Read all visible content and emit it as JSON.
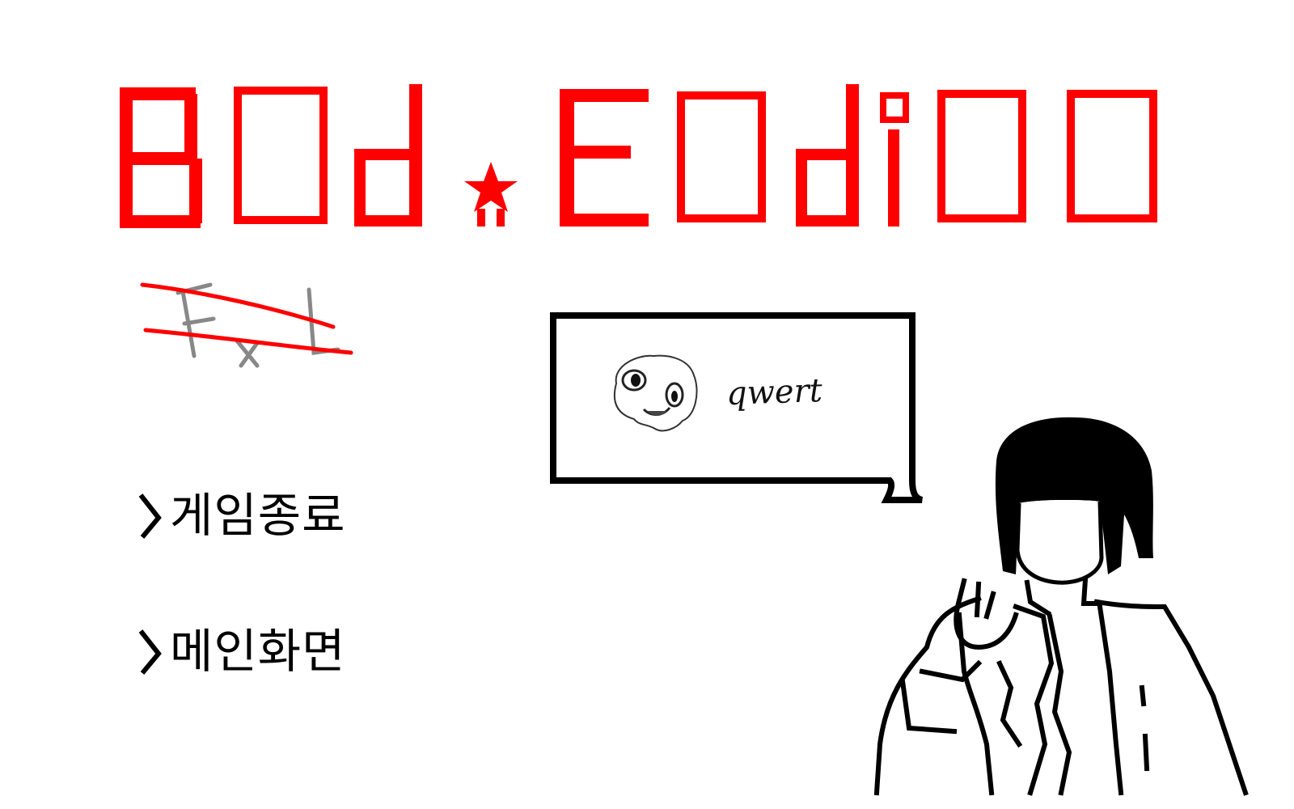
{
  "title": {
    "glyphs": [
      "B",
      "□",
      "d",
      "★",
      "E",
      "□",
      "d",
      "i",
      "□",
      "□"
    ],
    "color": "#ff0000"
  },
  "scribble": {
    "text": "FxL",
    "color": "#888888",
    "strike_color": "#ff0000"
  },
  "speech_bubble": {
    "speaker_icon": "skull-face-icon",
    "text": "qwert"
  },
  "menu": {
    "items": [
      {
        "label": "게임종료",
        "arrow_icon": "chevron-right-icon"
      },
      {
        "label": "메인화면",
        "arrow_icon": "chevron-right-icon"
      }
    ]
  },
  "character": {
    "icon": "girl-character-icon"
  },
  "colors": {
    "accent": "#ff0000",
    "ink": "#000000",
    "background": "#ffffff"
  }
}
